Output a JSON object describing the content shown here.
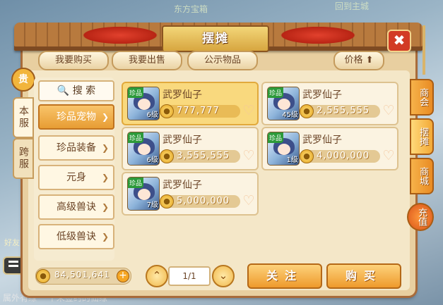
{
  "background": {
    "top_left_text": "东方宝箱",
    "top_right_text": "回到主城",
    "bottom_text": "属外有缘 一个未签约的仙缘",
    "haoyou_label": "好友"
  },
  "header": {
    "title": "摆摊",
    "close_label": "✖"
  },
  "top_tabs": {
    "buy": "我要购买",
    "sell": "我要出售",
    "public": "公示物品",
    "price_sort": "价格 ⬆"
  },
  "left_vtabs": {
    "badge": "贵",
    "ben": "本服",
    "kua": "跨服"
  },
  "sidebar": {
    "search_label": "🔍 搜 索",
    "items": [
      {
        "label": "珍品宠物",
        "selected": true
      },
      {
        "label": "珍品装备",
        "selected": false
      },
      {
        "label": "元身",
        "selected": false
      },
      {
        "label": "高级兽诀",
        "selected": false
      },
      {
        "label": "低级兽诀",
        "selected": false
      }
    ]
  },
  "listings": [
    {
      "name": "武罗仙子",
      "tag": "珍品",
      "level": "6级",
      "price": "777,777",
      "selected": true
    },
    {
      "name": "武罗仙子",
      "tag": "珍品",
      "level": "45级",
      "price": "2,555,555",
      "selected": false
    },
    {
      "name": "武罗仙子",
      "tag": "珍品",
      "level": "6级",
      "price": "3,555,555",
      "selected": false
    },
    {
      "name": "武罗仙子",
      "tag": "珍品",
      "level": "1级",
      "price": "4,000,000",
      "selected": false
    },
    {
      "name": "武罗仙子",
      "tag": "珍品",
      "level": "7级",
      "price": "5,000,000",
      "selected": false
    }
  ],
  "footer": {
    "balance": "84,501,641",
    "plus": "+",
    "page": "1/1",
    "prev": "⌃",
    "next": "⌄",
    "follow": "关注",
    "buy": "购买"
  },
  "right_tabs": {
    "shanghui": "商会",
    "baitan": "摆摊",
    "shangcheng": "商城",
    "chongzhi": "充值"
  },
  "colors": {
    "accent": "#ee9a2c",
    "panel": "#e8cfa0",
    "selected_card": "#f9d97e"
  }
}
